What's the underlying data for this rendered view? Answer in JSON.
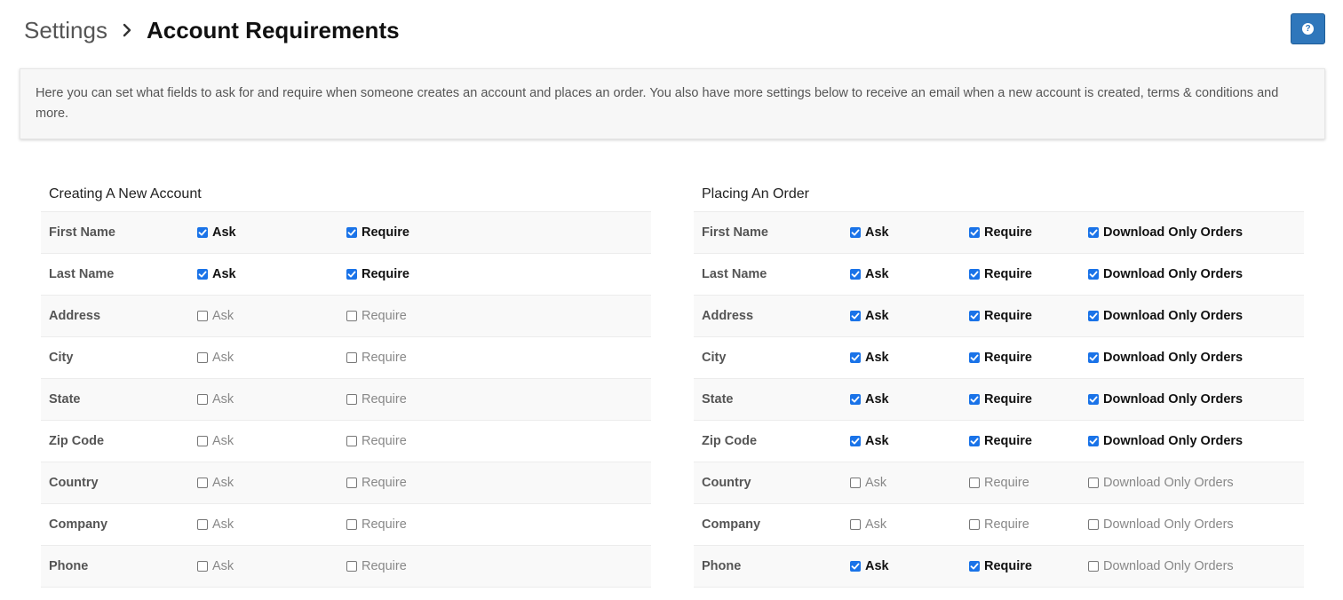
{
  "breadcrumb": {
    "root": "Settings",
    "current": "Account Requirements"
  },
  "help_button": {
    "icon": "question-circle-icon",
    "glyph": "?"
  },
  "info": {
    "text": "Here you can set what fields to ask for and require when someone creates an account and places an order. You also have more settings below to receive an email when a new account is created, terms & conditions and more."
  },
  "labels": {
    "ask": "Ask",
    "require": "Require",
    "download_only": "Download Only Orders"
  },
  "colors": {
    "accent": "#1a73e8",
    "help_button": "#2f77bb"
  },
  "new_account": {
    "title": "Creating A New Account",
    "rows": [
      {
        "field": "First Name",
        "ask": true,
        "require": true
      },
      {
        "field": "Last Name",
        "ask": true,
        "require": true
      },
      {
        "field": "Address",
        "ask": false,
        "require": false
      },
      {
        "field": "City",
        "ask": false,
        "require": false
      },
      {
        "field": "State",
        "ask": false,
        "require": false
      },
      {
        "field": "Zip Code",
        "ask": false,
        "require": false
      },
      {
        "field": "Country",
        "ask": false,
        "require": false
      },
      {
        "field": "Company",
        "ask": false,
        "require": false
      },
      {
        "field": "Phone",
        "ask": false,
        "require": false
      }
    ]
  },
  "placing_order": {
    "title": "Placing An Order",
    "rows": [
      {
        "field": "First Name",
        "ask": true,
        "require": true,
        "download_only": true
      },
      {
        "field": "Last Name",
        "ask": true,
        "require": true,
        "download_only": true
      },
      {
        "field": "Address",
        "ask": true,
        "require": true,
        "download_only": true
      },
      {
        "field": "City",
        "ask": true,
        "require": true,
        "download_only": true
      },
      {
        "field": "State",
        "ask": true,
        "require": true,
        "download_only": true
      },
      {
        "field": "Zip Code",
        "ask": true,
        "require": true,
        "download_only": true
      },
      {
        "field": "Country",
        "ask": false,
        "require": false,
        "download_only": false
      },
      {
        "field": "Company",
        "ask": false,
        "require": false,
        "download_only": false
      },
      {
        "field": "Phone",
        "ask": true,
        "require": true,
        "download_only": false
      }
    ]
  }
}
